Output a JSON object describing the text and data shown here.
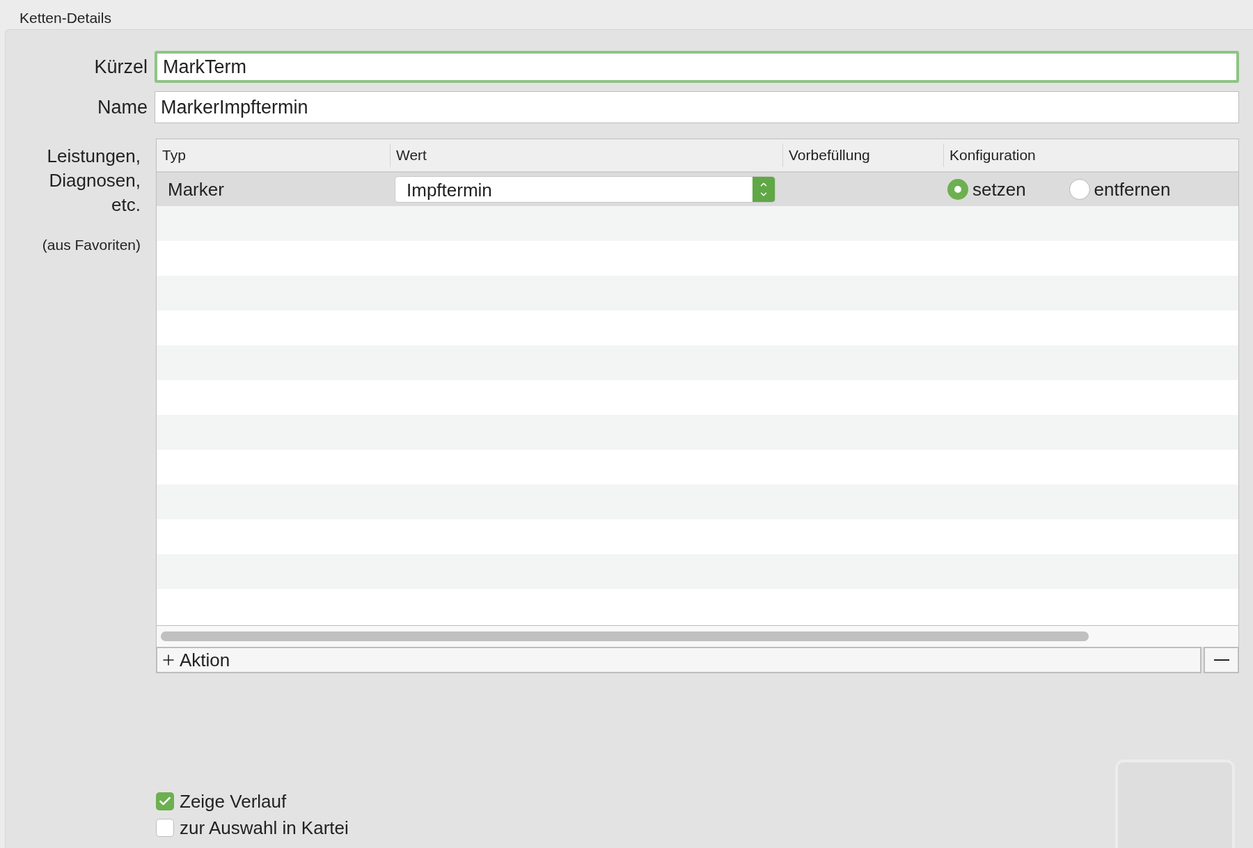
{
  "section_title": "Ketten-Details",
  "fields": [
    {
      "label": "Kürzel",
      "value": "MarkTerm",
      "focused": true
    },
    {
      "label": "Name",
      "value": "MarkerImpftermin",
      "focused": false
    }
  ],
  "actions_table": {
    "label": "Leistungen, Diagnosen, etc.",
    "note": "(aus Favoriten)",
    "columns": [
      "Typ",
      "Wert",
      "Vorbefüllung",
      "Konfiguration"
    ],
    "rows": [
      {
        "type": "Marker",
        "value": "Impftermin",
        "selected": true,
        "options": [
          {
            "label": "setzen",
            "selected": true
          },
          {
            "label": "entfernen",
            "selected": false
          }
        ]
      }
    ],
    "add_button": "Aktion"
  },
  "checkboxes": [
    {
      "label": "Zeige Verlauf",
      "checked": true
    },
    {
      "label": "zur Auswahl in Kartei",
      "checked": false
    }
  ]
}
